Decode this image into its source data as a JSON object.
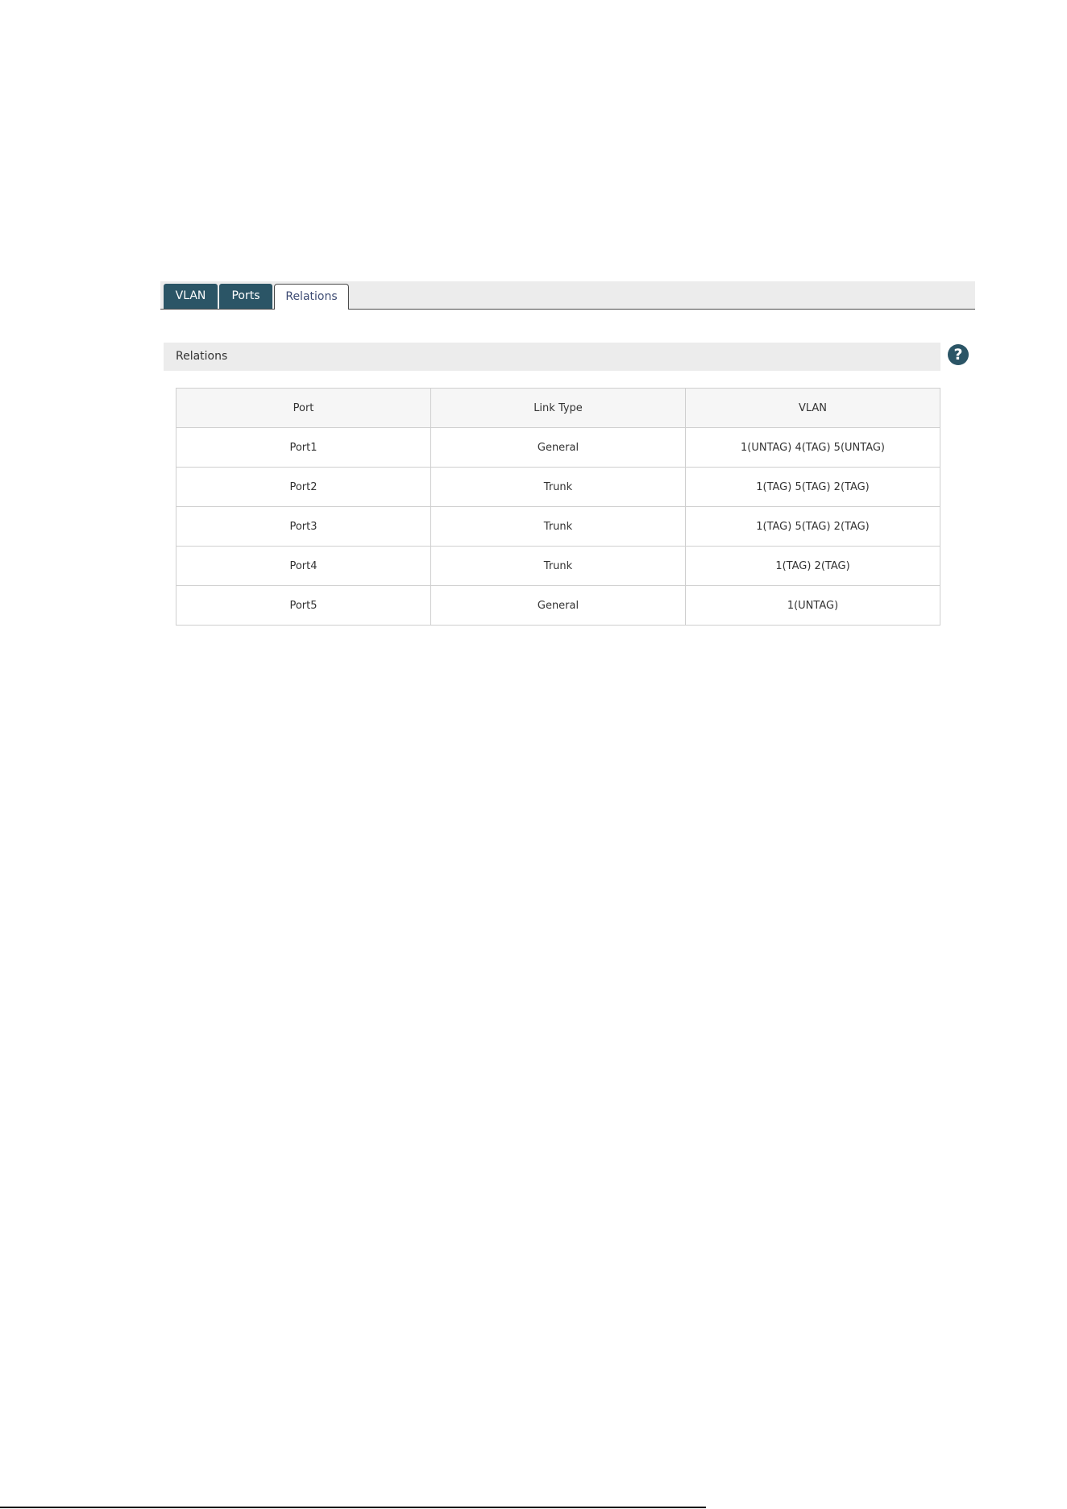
{
  "tabs": [
    {
      "label": "VLAN",
      "active": false
    },
    {
      "label": "Ports",
      "active": false
    },
    {
      "label": "Relations",
      "active": true
    }
  ],
  "section": {
    "title": "Relations",
    "help_icon": "question-mark"
  },
  "table": {
    "headers": [
      "Port",
      "Link Type",
      "VLAN"
    ],
    "rows": [
      [
        "Port1",
        "General",
        "1(UNTAG) 4(TAG) 5(UNTAG)"
      ],
      [
        "Port2",
        "Trunk",
        "1(TAG) 5(TAG) 2(TAG)"
      ],
      [
        "Port3",
        "Trunk",
        "1(TAG) 5(TAG) 2(TAG)"
      ],
      [
        "Port4",
        "Trunk",
        "1(TAG) 2(TAG)"
      ],
      [
        "Port5",
        "General",
        "1(UNTAG)"
      ]
    ]
  },
  "colors": {
    "tab_dark": "#2b5566",
    "header_bg": "#ececec",
    "help_icon": "#2b5566"
  }
}
